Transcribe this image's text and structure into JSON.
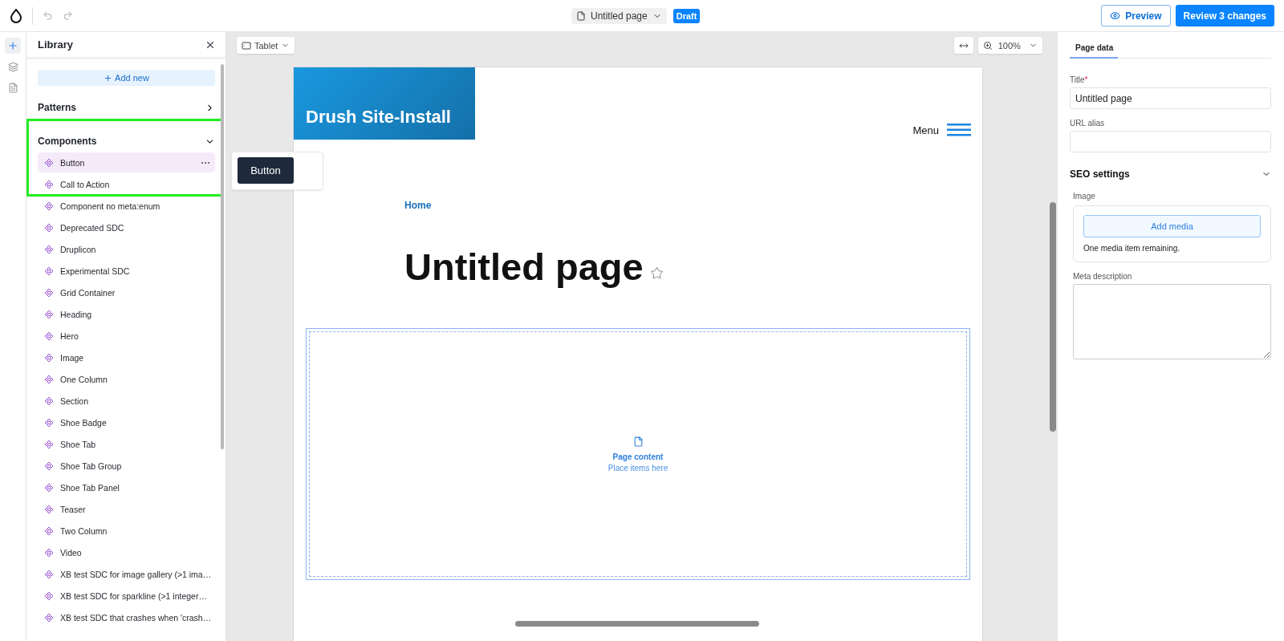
{
  "topbar": {
    "page_title": "Untitled page",
    "status": "Draft",
    "preview": "Preview",
    "review": "Review 3 changes"
  },
  "rail": [
    {
      "kind": "add",
      "selected": true
    },
    {
      "kind": "layers",
      "selected": false
    },
    {
      "kind": "page",
      "selected": false
    }
  ],
  "library": {
    "title": "Library",
    "add_new": "Add new",
    "sections": [
      {
        "label": "Patterns",
        "expanded": false,
        "highlighted": false
      },
      {
        "label": "Components",
        "expanded": true,
        "highlighted": true,
        "items": [
          {
            "label": "Button",
            "selected": true
          },
          {
            "label": "Call to Action",
            "selected": false
          },
          {
            "label": "Component no meta:enum",
            "selected": false
          },
          {
            "label": "Deprecated SDC",
            "selected": false
          },
          {
            "label": "Druplicon",
            "selected": false
          },
          {
            "label": "Experimental SDC",
            "selected": false
          },
          {
            "label": "Grid Container",
            "selected": false
          },
          {
            "label": "Heading",
            "selected": false
          },
          {
            "label": "Hero",
            "selected": false
          },
          {
            "label": "Image",
            "selected": false
          },
          {
            "label": "One Column",
            "selected": false
          },
          {
            "label": "Section",
            "selected": false
          },
          {
            "label": "Shoe Badge",
            "selected": false
          },
          {
            "label": "Shoe Tab",
            "selected": false
          },
          {
            "label": "Shoe Tab Group",
            "selected": false
          },
          {
            "label": "Shoe Tab Panel",
            "selected": false
          },
          {
            "label": "Teaser",
            "selected": false
          },
          {
            "label": "Two Column",
            "selected": false
          },
          {
            "label": "Video",
            "selected": false
          },
          {
            "label": "XB test SDC for image gallery (>1 ima…",
            "selected": false
          },
          {
            "label": "XB test SDC for sparkline (>1 integer…",
            "selected": false
          },
          {
            "label": "XB test SDC that crashes when 'crash…",
            "selected": false
          }
        ]
      }
    ],
    "preview_tooltip": "Button"
  },
  "canvas": {
    "device": "Tablet",
    "zoom": "100%",
    "site_name": "Drush Site-Install",
    "menu": "Menu",
    "breadcrumb": "Home",
    "heading": "Untitled page",
    "dropzone": {
      "title": "Page content",
      "hint": "Place items here"
    }
  },
  "settings": {
    "tabs": [
      {
        "label": "Page data",
        "selected": true
      }
    ],
    "title_field": {
      "label": "Title",
      "required_mark": "*",
      "value": "Untitled page"
    },
    "url_field": {
      "label": "URL alias"
    },
    "seo": {
      "label": "SEO settings",
      "expanded": true,
      "image_label": "Image",
      "add_media": "Add media",
      "remaining": "One media item remaining.",
      "meta_label": "Meta description"
    }
  }
}
